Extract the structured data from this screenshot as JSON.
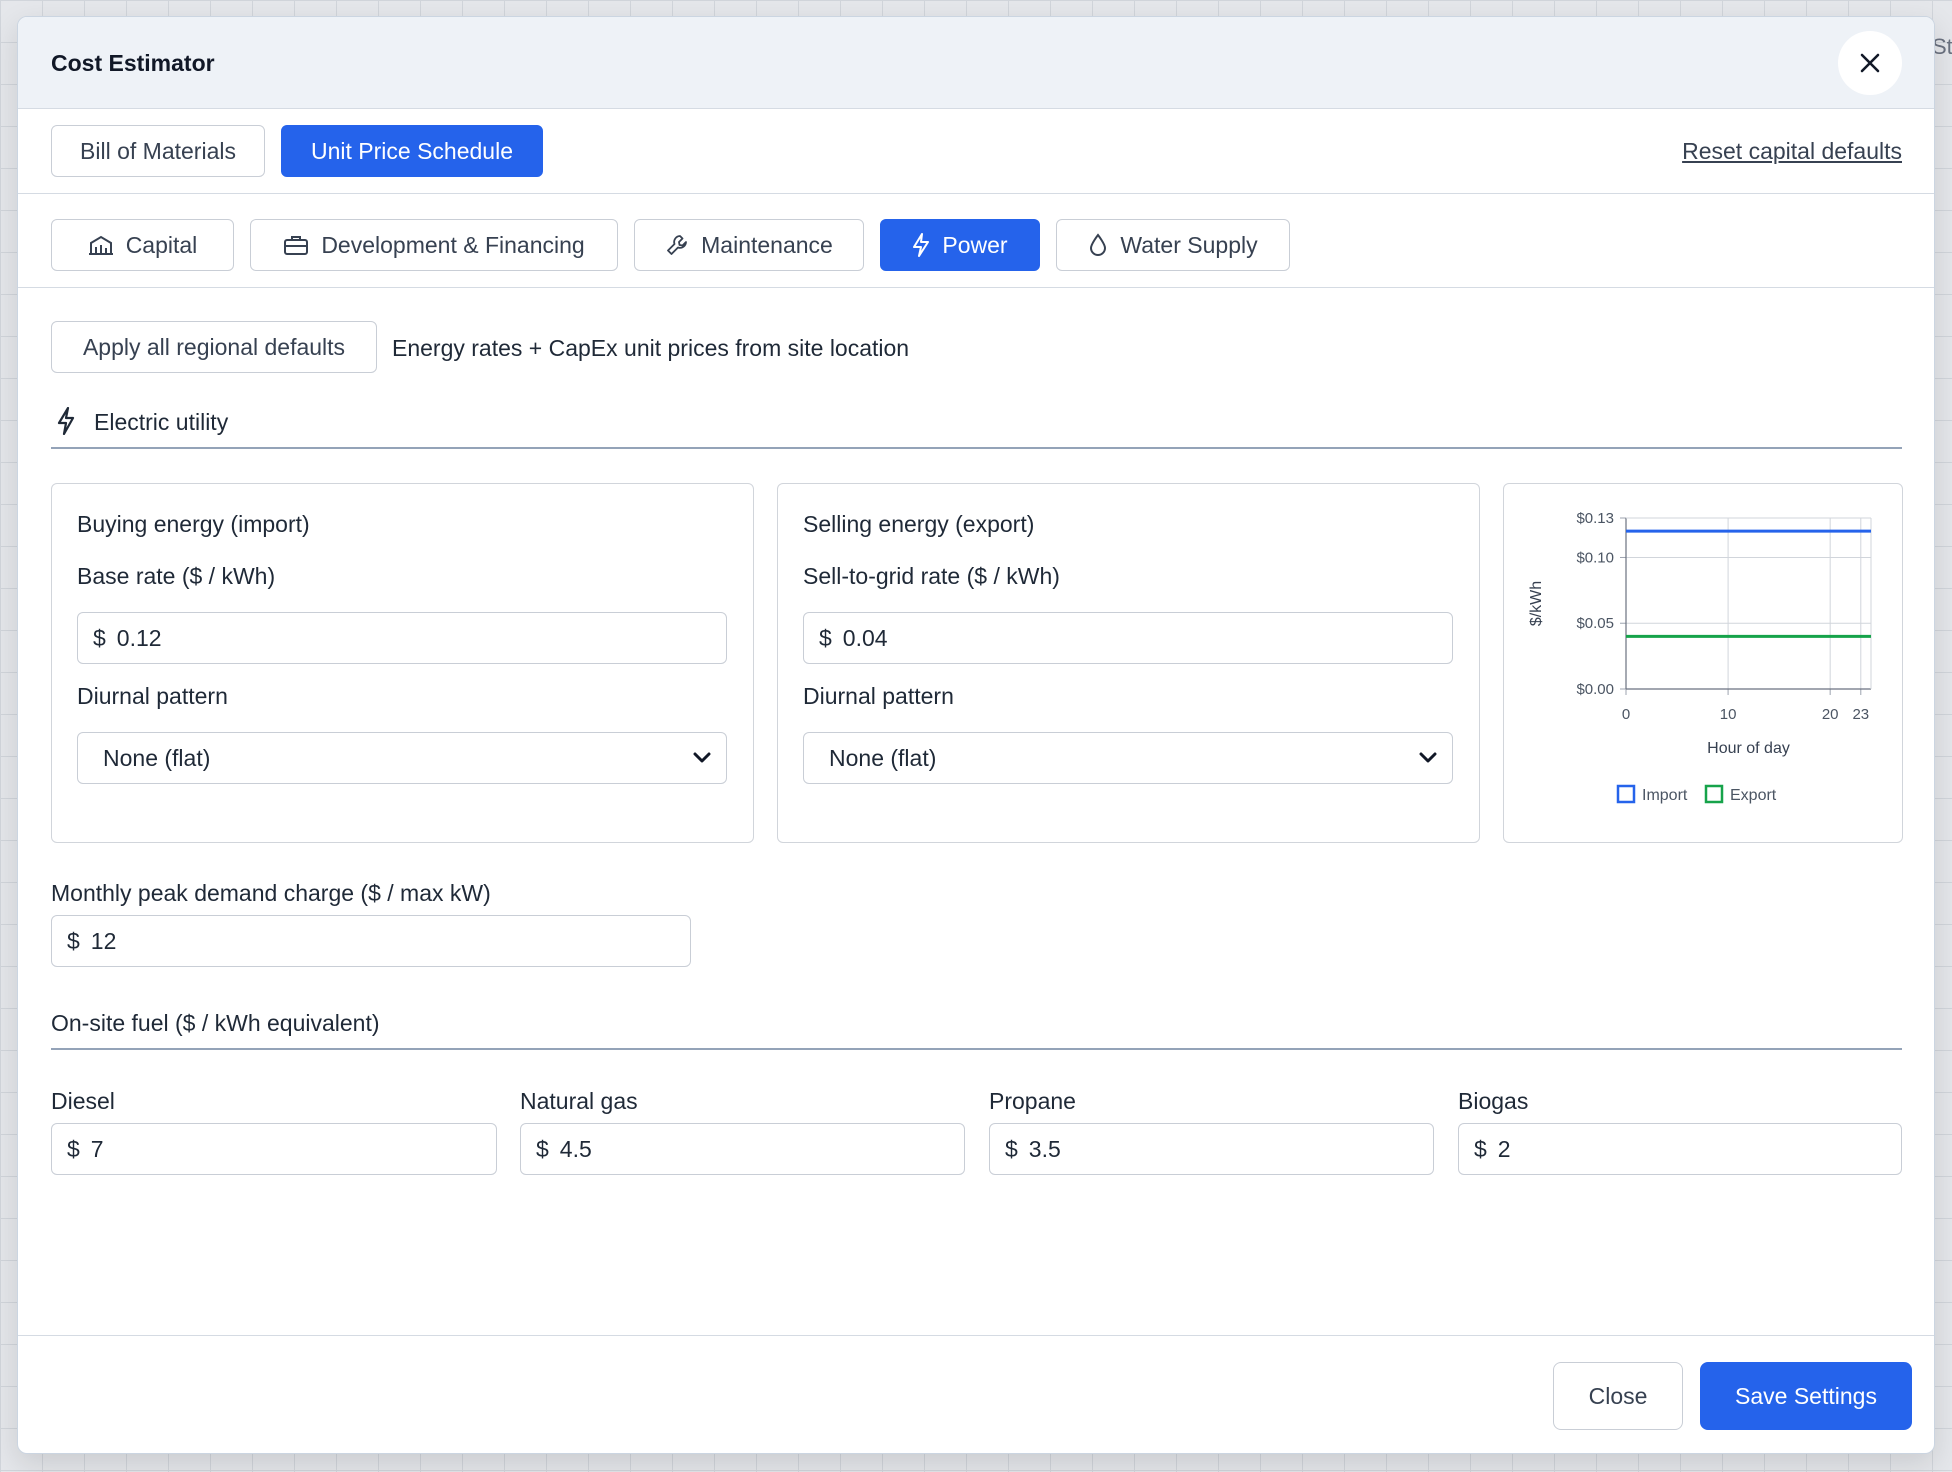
{
  "background": {
    "edge_text": "St"
  },
  "modal": {
    "title": "Cost Estimator"
  },
  "tabs": [
    {
      "label": "Bill of Materials",
      "active": false
    },
    {
      "label": "Unit Price Schedule",
      "active": true
    }
  ],
  "reset_link": "Reset capital defaults",
  "subtabs": [
    {
      "label": "Capital",
      "icon": "building-icon",
      "active": false
    },
    {
      "label": "Development & Financing",
      "icon": "briefcase-icon",
      "active": false
    },
    {
      "label": "Maintenance",
      "icon": "wrench-icon",
      "active": false
    },
    {
      "label": "Power",
      "icon": "lightning-icon",
      "active": true
    },
    {
      "label": "Water Supply",
      "icon": "droplet-icon",
      "active": false
    }
  ],
  "apply_defaults": {
    "button_label": "Apply all regional defaults",
    "description": "Energy rates + CapEx unit prices from site location"
  },
  "electric_utility": {
    "heading": "Electric utility",
    "icon": "lightning-icon",
    "buying": {
      "heading": "Buying energy (import)",
      "rate_label": "Base rate ($ / kWh)",
      "currency": "$",
      "rate_value": "0.12",
      "pattern_label": "Diurnal pattern",
      "pattern_value": "None (flat)"
    },
    "selling": {
      "heading": "Selling energy (export)",
      "rate_label": "Sell-to-grid rate ($ / kWh)",
      "currency": "$",
      "rate_value": "0.04",
      "pattern_label": "Diurnal pattern",
      "pattern_value": "None (flat)"
    },
    "demand": {
      "label": "Monthly peak demand charge ($ / max kW)",
      "currency": "$",
      "value": "12"
    }
  },
  "fuel": {
    "heading": "On-site fuel ($ / kWh equivalent)",
    "items": [
      {
        "label": "Diesel",
        "currency": "$",
        "value": "7"
      },
      {
        "label": "Natural gas",
        "currency": "$",
        "value": "4.5"
      },
      {
        "label": "Propane",
        "currency": "$",
        "value": "3.5"
      },
      {
        "label": "Biogas",
        "currency": "$",
        "value": "2"
      }
    ]
  },
  "footer": {
    "close_label": "Close",
    "save_label": "Save Settings"
  },
  "colors": {
    "accent": "#2563eb",
    "import_line": "#2563eb",
    "export_line": "#16a34a"
  },
  "chart_data": {
    "type": "line",
    "title": "",
    "xlabel": "Hour of day",
    "ylabel": "$/kWh",
    "xlim": [
      0,
      24
    ],
    "ylim": [
      0,
      0.13
    ],
    "x_ticks": [
      0,
      10,
      20,
      23
    ],
    "y_ticks": [
      {
        "value": 0,
        "label": "$0.00"
      },
      {
        "value": 0.05,
        "label": "$0.05"
      },
      {
        "value": 0.1,
        "label": "$0.10"
      },
      {
        "value": 0.13,
        "label": "$0.13"
      }
    ],
    "grid": true,
    "legend": "bottom",
    "series": [
      {
        "name": "Import",
        "color": "#2563eb",
        "x": [
          0,
          24
        ],
        "values": [
          0.12,
          0.12
        ]
      },
      {
        "name": "Export",
        "color": "#16a34a",
        "x": [
          0,
          24
        ],
        "values": [
          0.04,
          0.04
        ]
      }
    ]
  }
}
